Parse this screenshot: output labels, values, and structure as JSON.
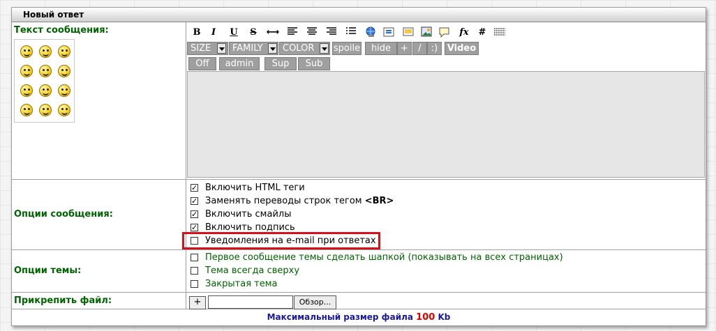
{
  "form": {
    "title": "Новый ответ",
    "message_label": "Текст сообщения:",
    "options_label": "Опции сообщения:",
    "topic_options_label": "Опции темы:",
    "attach_label": "Прикрепить файл:"
  },
  "toolbar": {
    "icons": [
      "bold-icon",
      "italic-icon",
      "underline-icon",
      "strikethrough-icon",
      "hr-icon",
      "align-left-icon",
      "align-center-icon",
      "align-right-icon",
      "list-icon",
      "link-icon",
      "quote-icon",
      "image-icon",
      "picture-icon",
      "comment-icon",
      "formula-icon",
      "hash-icon",
      "table-icon"
    ],
    "bold": "B",
    "italic": "I",
    "underline": "U",
    "strike": "S",
    "arrows": "⟷",
    "fx": "fx",
    "hash": "#",
    "size_label": "SIZE",
    "family_label": "FAMILY",
    "color_label": "COLOR",
    "spoiler_label": "spoile",
    "hide_label": "hide",
    "plus_label": "+",
    "slash_label": "/",
    "smile_label": ":)",
    "video_label": "Video",
    "off_label": "Off",
    "admin_label": "admin",
    "sup_label": "Sup",
    "sub_label": "Sub"
  },
  "message_options": [
    {
      "label": "Включить HTML теги",
      "checked": true
    },
    {
      "label": "Заменять переводы строк тегом ",
      "tag": "<BR>",
      "checked": true
    },
    {
      "label": "Включить смайлы",
      "checked": true
    },
    {
      "label": "Включить подпись",
      "checked": true
    },
    {
      "label": "Уведомления на e-mail при ответах",
      "checked": false
    }
  ],
  "topic_options": [
    {
      "label": "Первое сообщение темы сделать шапкой (показывать на всех страницах)",
      "checked": false
    },
    {
      "label": "Тема всегда сверху",
      "checked": false
    },
    {
      "label": "Закрытая тема",
      "checked": false
    }
  ],
  "attach": {
    "plus_label": "+",
    "file_value": "",
    "browse_label": "Обзор..."
  },
  "footer": {
    "text": "Максимальный размер файла ",
    "size": "100",
    "unit": " Kb"
  },
  "colors": {
    "label_green": "#006400",
    "highlight_red": "#d8101c",
    "footer_blue": "#1a1aa0",
    "button_gray": "#9f9f9f"
  }
}
